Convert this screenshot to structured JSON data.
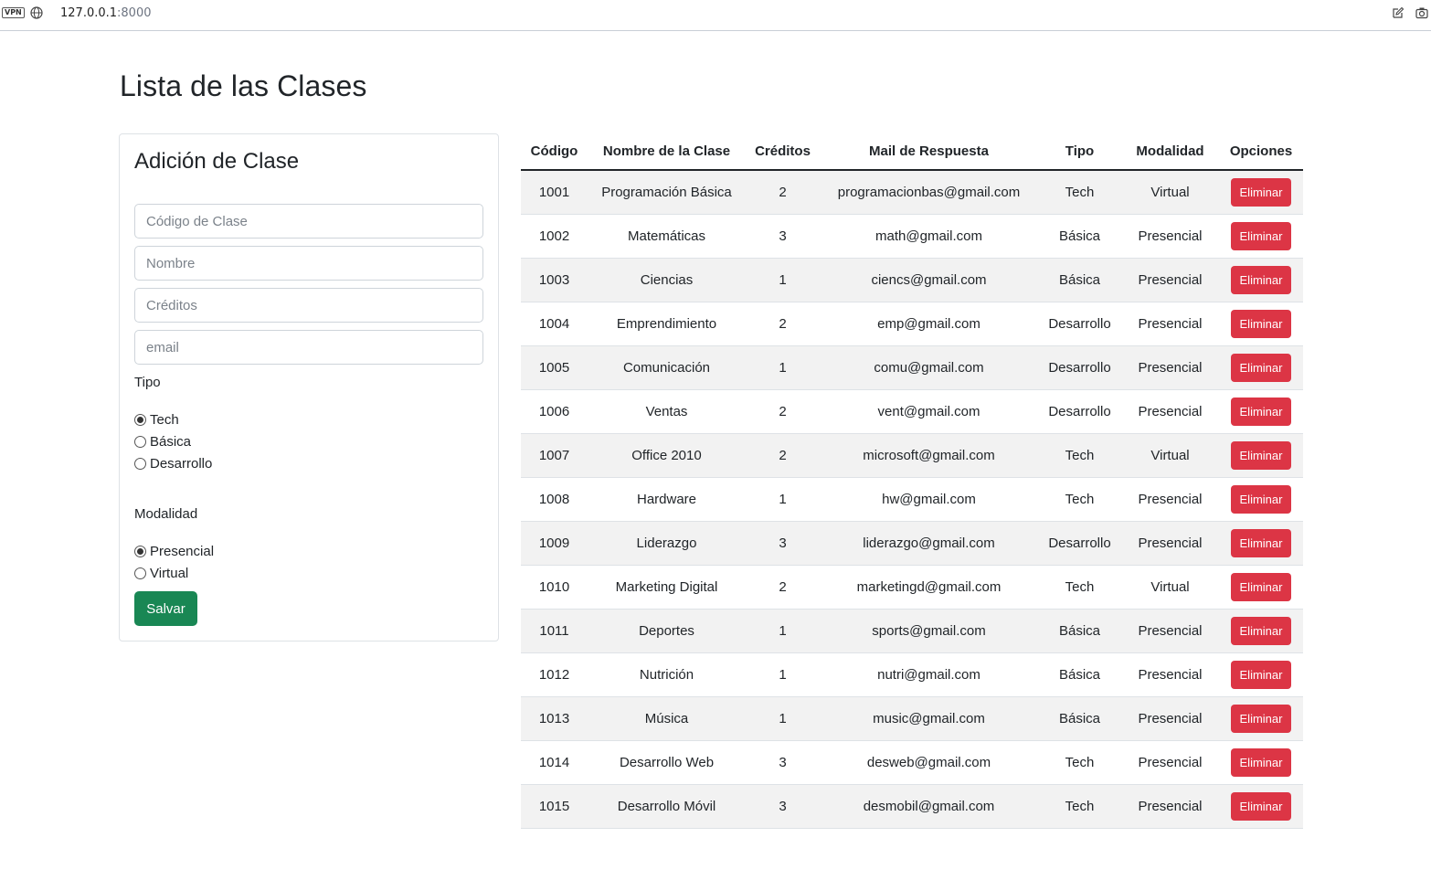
{
  "browser": {
    "vpn": "VPN",
    "url_host": "127.0.0.1",
    "url_port": ":8000"
  },
  "page": {
    "title": "Lista de las Clases"
  },
  "form": {
    "title": "Adición de Clase",
    "placeholders": {
      "code": "Código de Clase",
      "name": "Nombre",
      "credits": "Créditos",
      "email": "email"
    },
    "tipo_label": "Tipo",
    "tipo_options": [
      "Tech",
      "Básica",
      "Desarrollo"
    ],
    "tipo_selected": "Tech",
    "modalidad_label": "Modalidad",
    "modalidad_options": [
      "Presencial",
      "Virtual"
    ],
    "modalidad_selected": "Presencial",
    "save_label": "Salvar"
  },
  "table": {
    "headers": [
      "Código",
      "Nombre de la Clase",
      "Créditos",
      "Mail de Respuesta",
      "Tipo",
      "Modalidad",
      "Opciones"
    ],
    "delete_label": "Eliminar",
    "rows": [
      [
        "1001",
        "Programación Básica",
        "2",
        "programacionbas@gmail.com",
        "Tech",
        "Virtual"
      ],
      [
        "1002",
        "Matemáticas",
        "3",
        "math@gmail.com",
        "Básica",
        "Presencial"
      ],
      [
        "1003",
        "Ciencias",
        "1",
        "ciencs@gmail.com",
        "Básica",
        "Presencial"
      ],
      [
        "1004",
        "Emprendimiento",
        "2",
        "emp@gmail.com",
        "Desarrollo",
        "Presencial"
      ],
      [
        "1005",
        "Comunicación",
        "1",
        "comu@gmail.com",
        "Desarrollo",
        "Presencial"
      ],
      [
        "1006",
        "Ventas",
        "2",
        "vent@gmail.com",
        "Desarrollo",
        "Presencial"
      ],
      [
        "1007",
        "Office 2010",
        "2",
        "microsoft@gmail.com",
        "Tech",
        "Virtual"
      ],
      [
        "1008",
        "Hardware",
        "1",
        "hw@gmail.com",
        "Tech",
        "Presencial"
      ],
      [
        "1009",
        "Liderazgo",
        "3",
        "liderazgo@gmail.com",
        "Desarrollo",
        "Presencial"
      ],
      [
        "1010",
        "Marketing Digital",
        "2",
        "marketingd@gmail.com",
        "Tech",
        "Virtual"
      ],
      [
        "1011",
        "Deportes",
        "1",
        "sports@gmail.com",
        "Básica",
        "Presencial"
      ],
      [
        "1012",
        "Nutrición",
        "1",
        "nutri@gmail.com",
        "Básica",
        "Presencial"
      ],
      [
        "1013",
        "Música",
        "1",
        "music@gmail.com",
        "Básica",
        "Presencial"
      ],
      [
        "1014",
        "Desarrollo Web",
        "3",
        "desweb@gmail.com",
        "Tech",
        "Presencial"
      ],
      [
        "1015",
        "Desarrollo Móvil",
        "3",
        "desmobil@gmail.com",
        "Tech",
        "Presencial"
      ]
    ]
  },
  "colors": {
    "save_button": "#198754",
    "delete_button": "#dc3545",
    "stripe": "#f2f2f2"
  }
}
